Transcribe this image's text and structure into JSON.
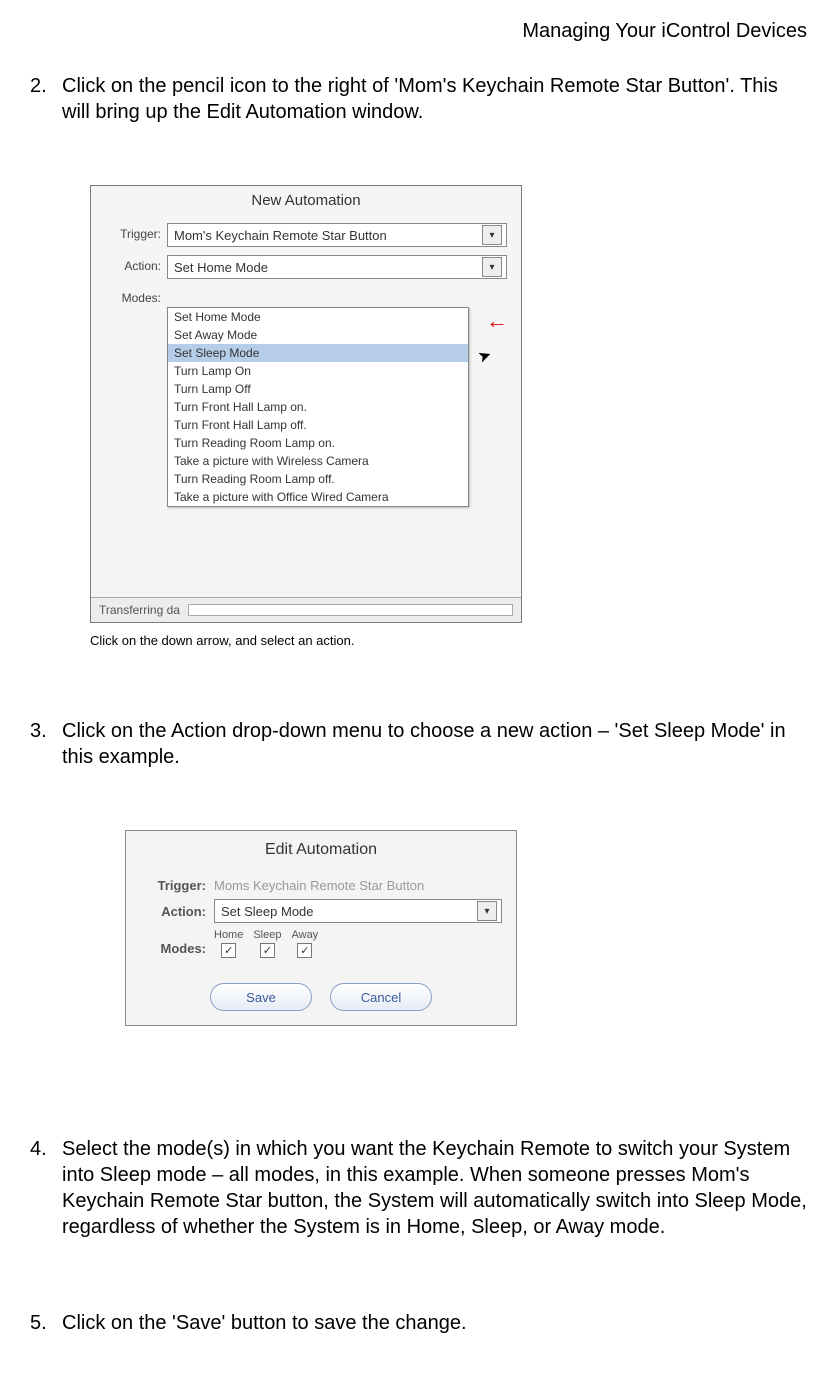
{
  "header": {
    "title": "Managing Your iControl Devices"
  },
  "steps": {
    "s2": {
      "num": "2.",
      "text": "Click on the pencil icon to the right of 'Mom's Keychain Remote Star Button'. This will bring up the Edit Automation window."
    },
    "s3": {
      "num": "3.",
      "text": "Click on the Action drop-down menu to choose a new action – 'Set Sleep Mode' in this example."
    },
    "s4": {
      "num": "4.",
      "text": "Select the mode(s) in which you want the Keychain Remote to switch your System into Sleep mode – all modes, in this example. When someone presses Mom's Keychain Remote Star button, the System will automatically switch into Sleep Mode, regardless of whether the System is in Home, Sleep, or Away mode."
    },
    "s5": {
      "num": "5.",
      "text": "Click on the 'Save' button to save the change."
    }
  },
  "fig1": {
    "title": "New Automation",
    "trigger_label": "Trigger:",
    "trigger_value": "Mom's Keychain Remote Star Button",
    "action_label": "Action:",
    "action_value": "Set Home Mode",
    "modes_label": "Modes:",
    "options": [
      "Set Home Mode",
      "Set Away Mode",
      "Set Sleep Mode",
      "Turn Lamp On",
      "Turn Lamp Off",
      "Turn Front Hall Lamp on.",
      "Turn Front Hall Lamp off.",
      "Turn Reading Room Lamp on.",
      "Take a picture with Wireless Camera",
      "Turn Reading Room Lamp off.",
      "Take a picture with Office Wired Camera"
    ],
    "highlight_index": 2,
    "transfer_text": "Transferring da",
    "caption": "Click on the down arrow, and select an action."
  },
  "fig2": {
    "title": "Edit Automation",
    "trigger_label": "Trigger:",
    "trigger_value": "Moms Keychain Remote Star Button",
    "action_label": "Action:",
    "action_value": "Set Sleep Mode",
    "modes_label": "Modes:",
    "modes": [
      {
        "name": "Home",
        "checked": true
      },
      {
        "name": "Sleep",
        "checked": true
      },
      {
        "name": "Away",
        "checked": true
      }
    ],
    "save_label": "Save",
    "cancel_label": "Cancel"
  }
}
